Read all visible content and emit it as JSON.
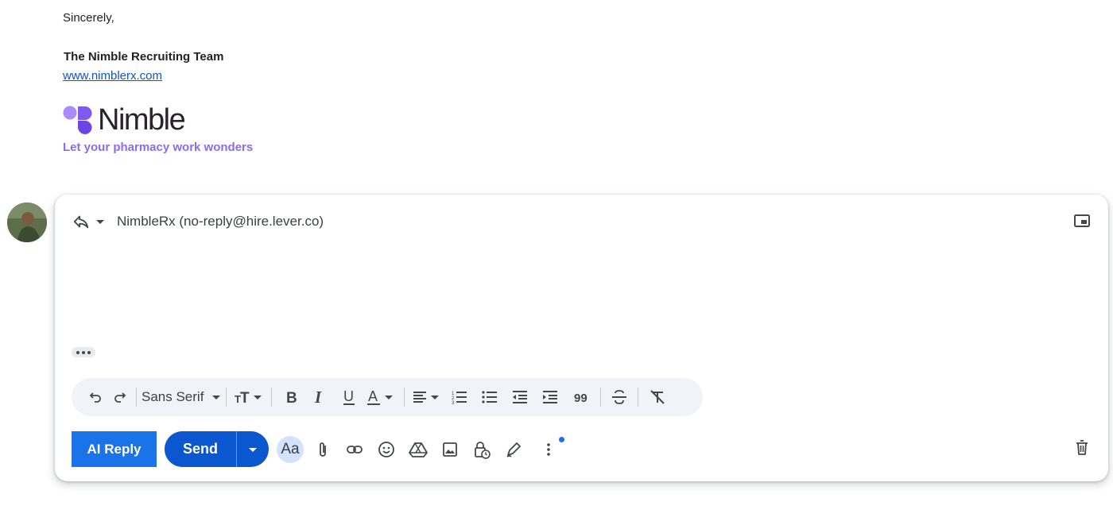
{
  "email_tail": {
    "closing": "Sincerely,",
    "team_name": "The Nimble Recruiting Team",
    "website": "www.nimblerx.com",
    "logo_wordmark": "Nimble",
    "tagline": "Let your pharmacy work wonders"
  },
  "compose": {
    "recipient": "NimbleRx (no-reply@hire.lever.co)",
    "icons": {
      "reply": "reply-icon",
      "reply_type": "chevron-down-icon",
      "popout": "pop-out-icon",
      "trimmed": "more-horiz-icon"
    }
  },
  "format_toolbar": {
    "font": "Sans Serif",
    "buttons": [
      "undo",
      "redo",
      "font",
      "text-size",
      "bold",
      "italic",
      "underline",
      "text-color",
      "align",
      "numbered-list",
      "bulleted-list",
      "indent-less",
      "indent-more",
      "quote",
      "strikethrough",
      "remove-formatting"
    ]
  },
  "actions": {
    "ai_reply": "AI Reply",
    "send": "Send",
    "formatting_toggle": "Aa",
    "icons": [
      "attach-icon",
      "link-icon",
      "emoji-icon",
      "drive-icon",
      "photo-icon",
      "confidential-icon",
      "signature-icon",
      "more-vert-icon",
      "trash-icon"
    ]
  },
  "colors": {
    "accent": "#1a73e8",
    "send": "#0b57d0",
    "link": "#1155cc",
    "tagline": "#8b6cf0",
    "toolbar_bg": "#f1f3f9"
  }
}
